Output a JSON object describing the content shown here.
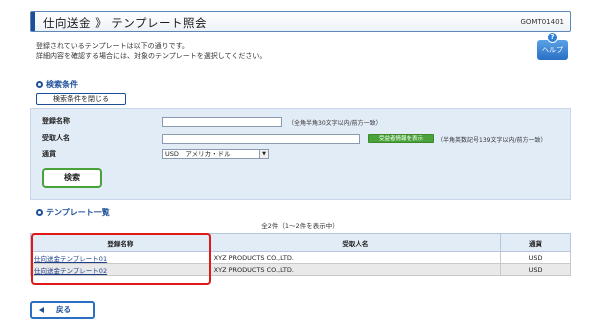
{
  "header": {
    "title": "仕向送金 》 テンプレート照会",
    "screen_id": "GOMT01401"
  },
  "intro": {
    "line1": "登録されているテンプレートは以下の通りです。",
    "line2": "詳細内容を確認する場合には、対象のテンプレートを選択してください。"
  },
  "help": {
    "label": "ヘルプ",
    "icon": "question-icon"
  },
  "search": {
    "section_title": "検索条件",
    "toggle_label": "検索条件を閉じる",
    "fields": {
      "template_name_label": "登録名称",
      "template_name_value": "",
      "template_name_hint": "（全角半角30文字以内/前方一致）",
      "recipient_label": "受取人名",
      "recipient_value": "",
      "recipient_button": "受益者情報を表示",
      "recipient_hint": "（半角英数記号139文字以内/前方一致）",
      "currency_label": "通貨",
      "currency_selected": "USD　アメリカ・ドル"
    },
    "search_button": "検索"
  },
  "list": {
    "section_title": "テンプレート一覧",
    "count_text": "全2件（1～2件を表示中）",
    "columns": [
      "登録名称",
      "受取人名",
      "通貨"
    ],
    "rows": [
      {
        "name": "仕向送金テンプレート01",
        "recipient": "XYZ PRODUCTS CO.,LTD.",
        "currency": "USD"
      },
      {
        "name": "仕向送金テンプレート02",
        "recipient": "XYZ PRODUCTS CO.,LTD.",
        "currency": "USD"
      }
    ]
  },
  "footer": {
    "back_label": "戻る"
  },
  "colors": {
    "accent": "#1d4f98",
    "green": "#4aa33a",
    "highlight": "#e01818",
    "panel": "#e2ecf7"
  }
}
